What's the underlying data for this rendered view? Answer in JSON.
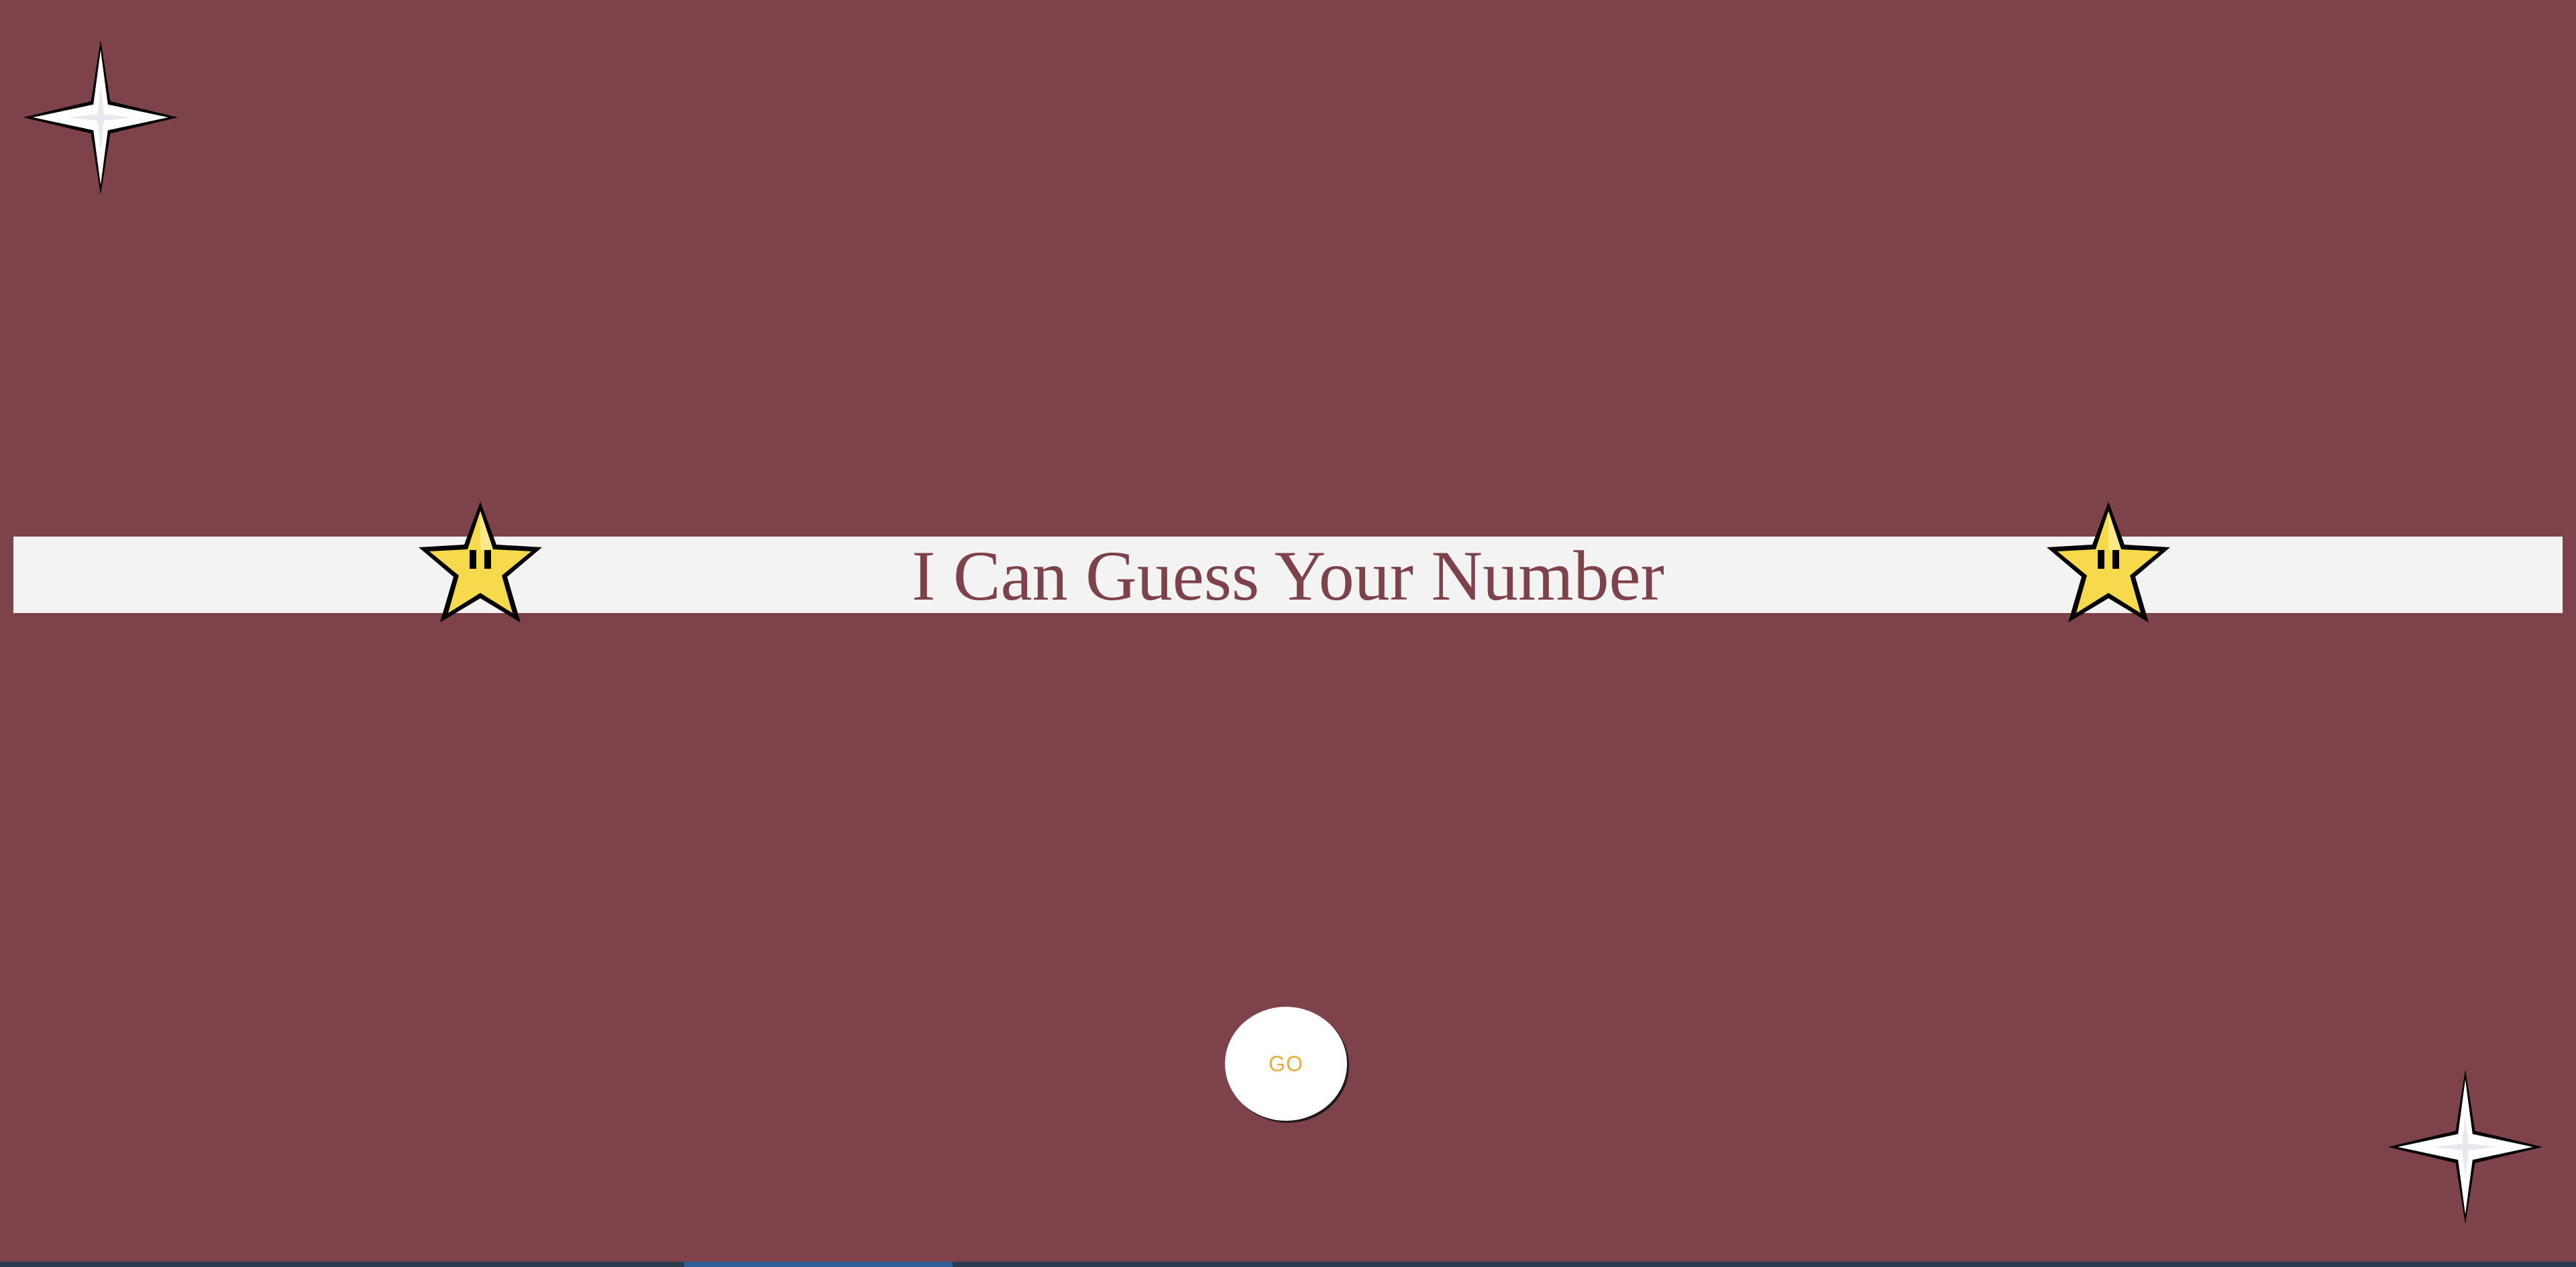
{
  "game": {
    "title": "I Can Guess Your Number",
    "go_label": "GO"
  },
  "colors": {
    "background": "#7e424a",
    "banner": "#f4f3f3",
    "title_text": "#7e424a",
    "button_text": "#e4ae36",
    "star_fill": "#f7d94c",
    "sparkle_fill": "#ffffff"
  },
  "icons": {
    "decor_top_left": "sparkle-icon",
    "decor_bottom_right": "sparkle-icon",
    "banner_left": "star-icon",
    "banner_right": "star-icon"
  }
}
